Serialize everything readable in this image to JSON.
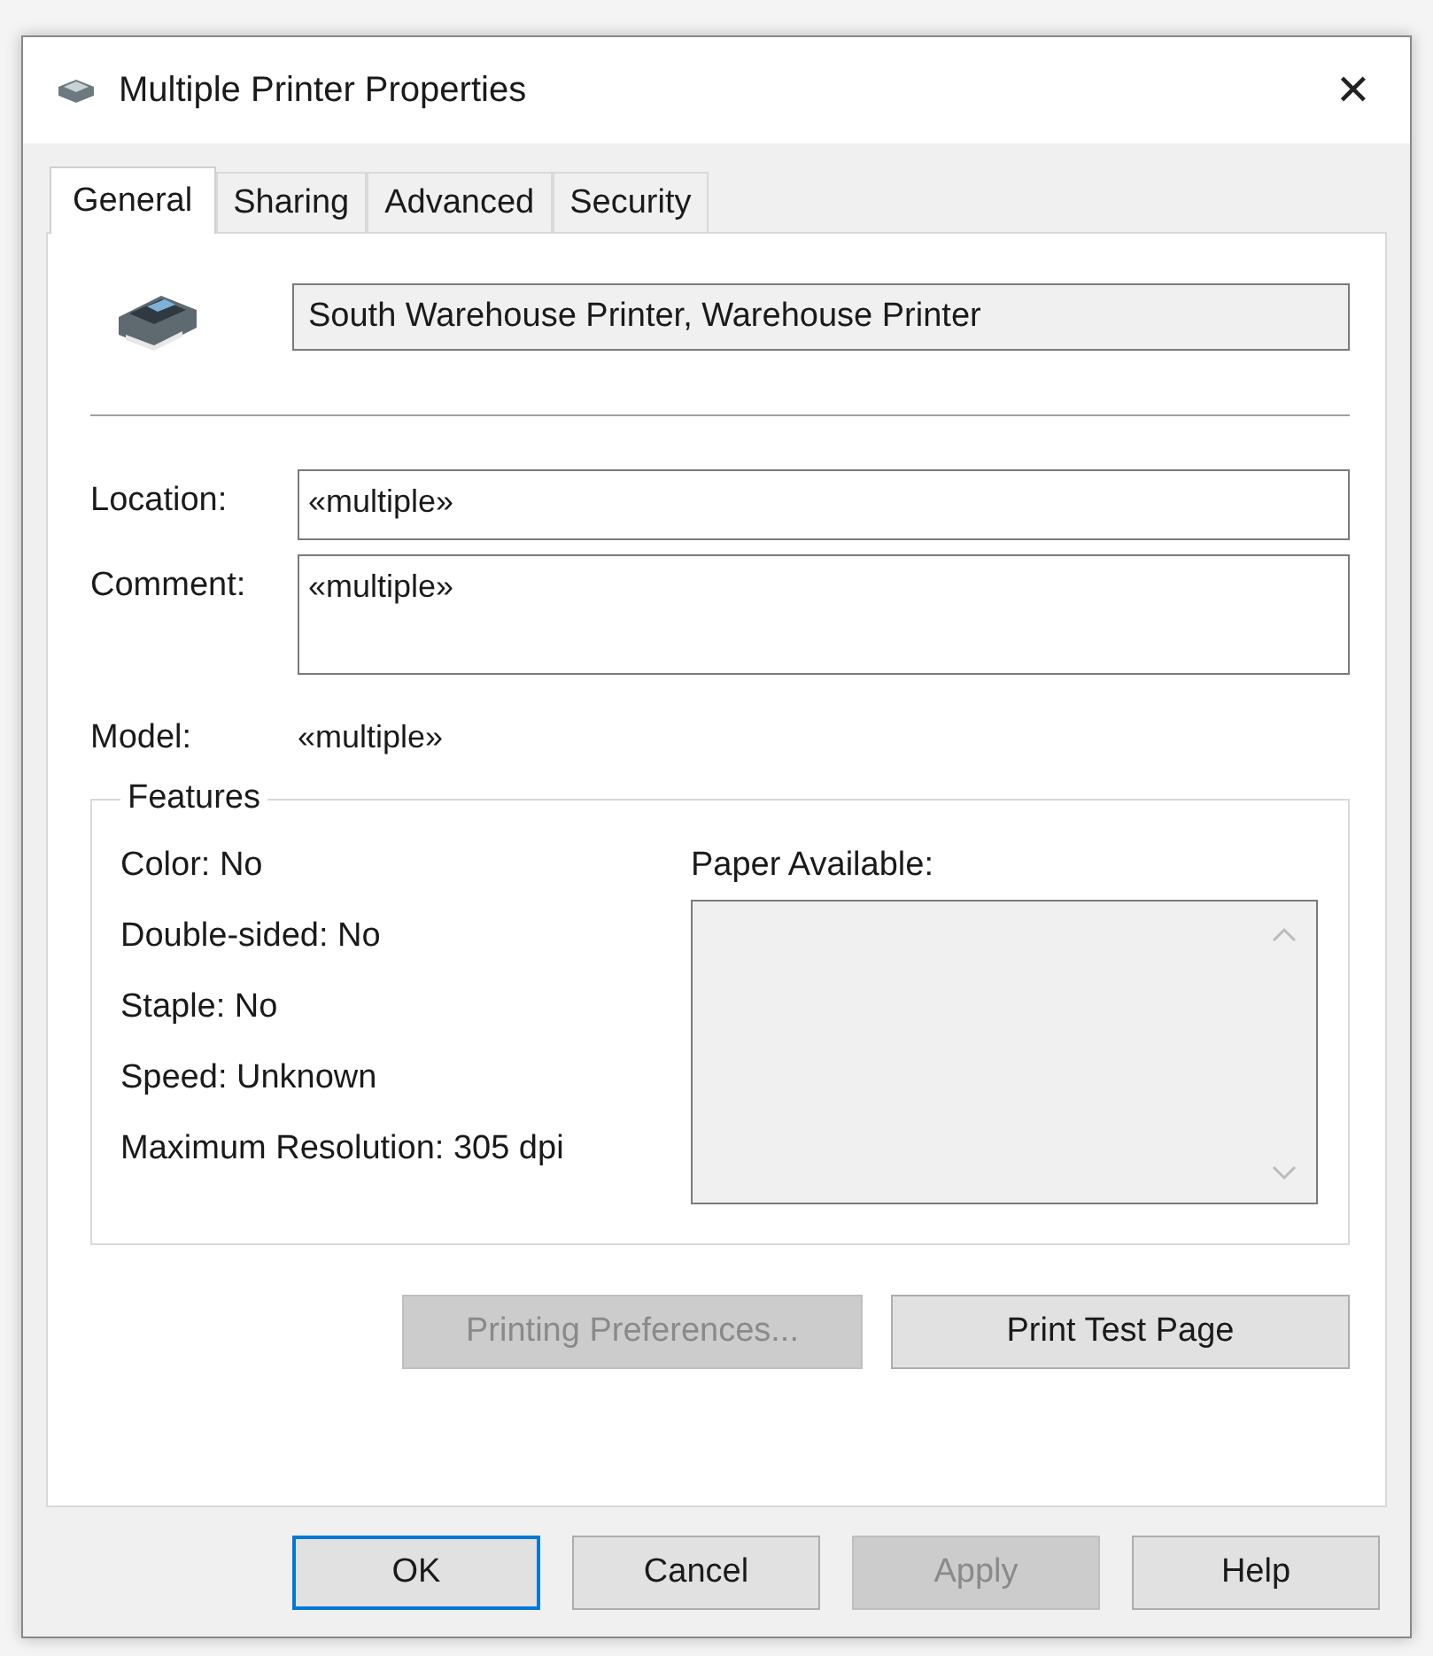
{
  "window": {
    "title": "Multiple Printer Properties",
    "close": "✕"
  },
  "tabs": [
    {
      "label": "General",
      "selected": true
    },
    {
      "label": "Sharing",
      "selected": false
    },
    {
      "label": "Advanced",
      "selected": false
    },
    {
      "label": "Security",
      "selected": false
    }
  ],
  "printer_names": "South Warehouse Printer, Warehouse Printer",
  "fields": [
    {
      "label": "Location:",
      "value": "«multiple»",
      "kind": "line"
    },
    {
      "label": "Comment:",
      "value": "«multiple»",
      "kind": "area"
    }
  ],
  "model": {
    "label": "Model:",
    "value": "«multiple»"
  },
  "features": {
    "title": "Features",
    "items": [
      "Color:  No",
      "Double-sided:  No",
      "Staple:  No",
      "Speed:  Unknown",
      "Maximum Resolution:  305 dpi"
    ],
    "paper_label": "Paper Available:"
  },
  "panel_buttons": [
    {
      "label": "Printing Preferences...",
      "disabled": true
    },
    {
      "label": "Print Test Page",
      "disabled": false
    }
  ],
  "buttons": [
    {
      "label": "OK",
      "disabled": false,
      "default": true
    },
    {
      "label": "Cancel",
      "disabled": false,
      "default": false
    },
    {
      "label": "Apply",
      "disabled": true,
      "default": false
    },
    {
      "label": "Help",
      "disabled": false,
      "default": false
    }
  ]
}
